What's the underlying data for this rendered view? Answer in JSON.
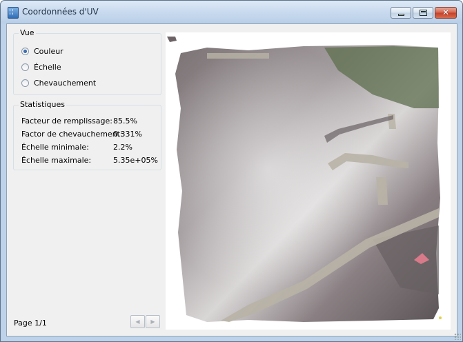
{
  "window": {
    "title": "Coordonnées d'UV"
  },
  "view_group": {
    "title": "Vue",
    "options": [
      {
        "label": "Couleur",
        "checked": true
      },
      {
        "label": "Échelle",
        "checked": false
      },
      {
        "label": "Chevauchement",
        "checked": false
      }
    ]
  },
  "stats_group": {
    "title": "Statistiques",
    "rows": [
      {
        "label": "Facteur de remplissage:",
        "value": "85.5%"
      },
      {
        "label": "Factor de chevauchement:",
        "value": "0.331%"
      },
      {
        "label": "Échelle minimale:",
        "value": "2.2%"
      },
      {
        "label": "Échelle maximale:",
        "value": "5.35e+05%"
      }
    ]
  },
  "pager": {
    "label": "Page 1/1",
    "prev_glyph": "◀",
    "next_glyph": "▶"
  },
  "preview": {
    "accent": "#5b5456",
    "path_color": "#b8b3a6",
    "grass_color": "#5d6f4e"
  }
}
